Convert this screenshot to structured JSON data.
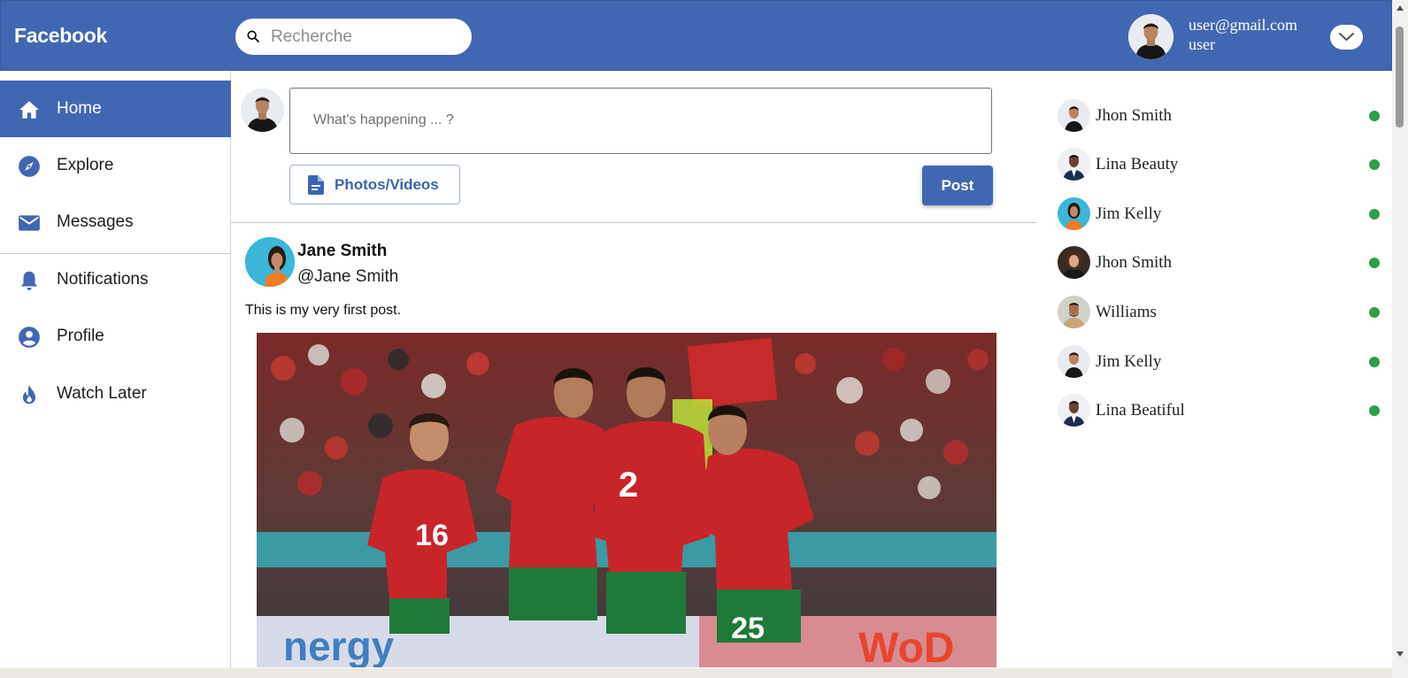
{
  "header": {
    "brand": "Facebook",
    "search_placeholder": "Recherche",
    "user_email": "user@gmail.com",
    "user_name": "user"
  },
  "sidebar": {
    "items": [
      {
        "label": "Home",
        "icon": "home-icon",
        "active": true
      },
      {
        "label": "Explore",
        "icon": "compass-icon",
        "active": false
      },
      {
        "label": "Messages",
        "icon": "mail-icon",
        "active": false
      },
      {
        "label": "Notifications",
        "icon": "bell-icon",
        "active": false
      },
      {
        "label": "Profile",
        "icon": "account-icon",
        "active": false
      },
      {
        "label": "Watch Later",
        "icon": "flame-icon",
        "active": false
      }
    ]
  },
  "composer": {
    "placeholder": "What's happening ... ?",
    "media_label": "Photos/Videos",
    "post_label": "Post"
  },
  "post": {
    "author": "Jane Smith",
    "handle": "@Jane Smith",
    "text": "This is my very first post.",
    "image_kit_numbers": [
      "16",
      "2",
      "25"
    ],
    "image_banner_text": "nergy",
    "image_banner_text_right": "WoD"
  },
  "contacts": [
    {
      "name": "Jhon Smith",
      "online": true
    },
    {
      "name": "Lina Beauty",
      "online": true
    },
    {
      "name": "Jim Kelly",
      "online": true
    },
    {
      "name": "Jhon Smith",
      "online": true
    },
    {
      "name": "Williams",
      "online": true
    },
    {
      "name": "Jim Kelly",
      "online": true
    },
    {
      "name": "Lina Beatiful",
      "online": true
    }
  ],
  "colors": {
    "brand_blue": "#4267b2",
    "online_green": "#2e9e48"
  }
}
